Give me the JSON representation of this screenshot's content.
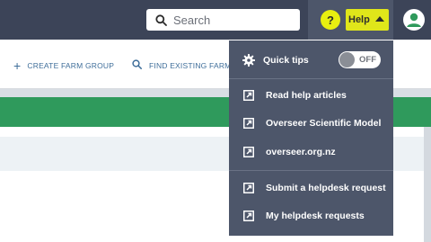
{
  "header": {
    "search": {
      "placeholder": "Search"
    },
    "help": {
      "badge": "?",
      "label": "Help"
    }
  },
  "actions": {
    "create": {
      "label": "CREATE FARM GROUP"
    },
    "find": {
      "label": "FIND EXISTING FARM"
    }
  },
  "help_menu": {
    "quick_tips": {
      "label": "Quick tips",
      "toggle_text": "OFF",
      "enabled": false
    },
    "items": [
      {
        "label": "Read help articles"
      },
      {
        "label": "Overseer Scientific Model"
      },
      {
        "label": "overseer.org.nz"
      },
      {
        "label": "Submit a helpdesk request"
      },
      {
        "label": "My helpdesk requests"
      }
    ]
  },
  "colors": {
    "topbar": "#3c4458",
    "dropdown": "#4d566a",
    "help_highlight": "#e0e61a",
    "green_band": "#2f9a5c",
    "link": "#3f6e9a"
  }
}
